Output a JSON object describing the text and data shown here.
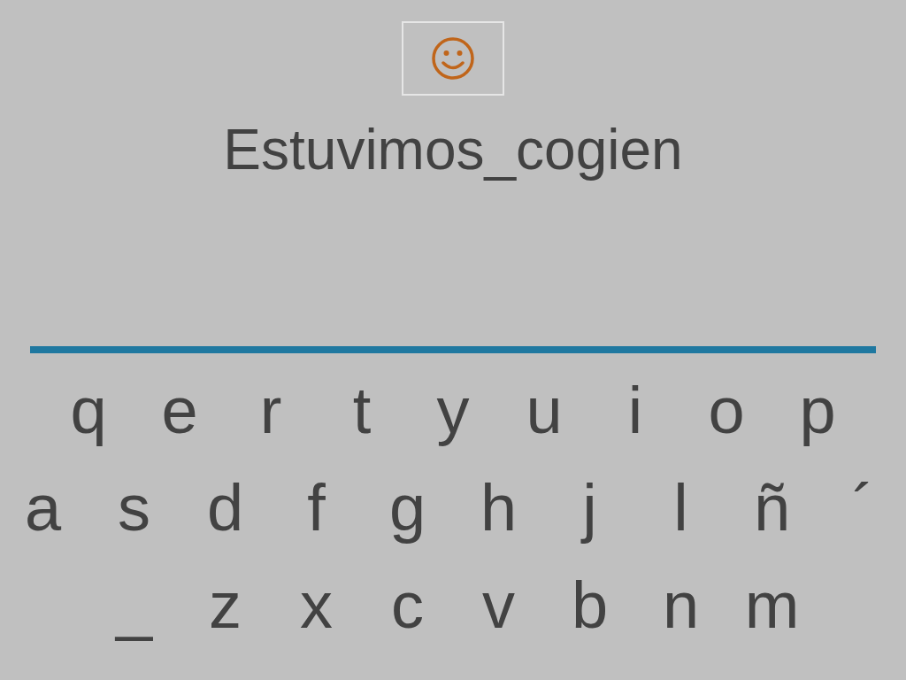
{
  "word": "Estuvimos_cogien",
  "keyboard": {
    "rows": [
      [
        "q",
        "e",
        "r",
        "t",
        "y",
        "u",
        "i",
        "o",
        "p"
      ],
      [
        "a",
        "s",
        "d",
        "f",
        "g",
        "h",
        "j",
        "l",
        "ñ",
        "´"
      ],
      [
        "_",
        "z",
        "x",
        "c",
        "v",
        "b",
        "n",
        "m"
      ]
    ]
  }
}
